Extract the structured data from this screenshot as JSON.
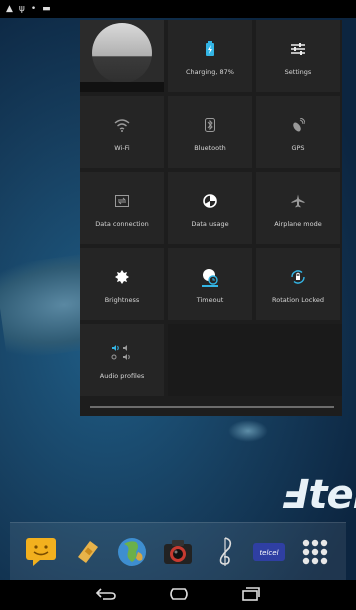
{
  "quick_settings": {
    "tiles": [
      {
        "id": "charging",
        "label": "Charging, 87%",
        "icon": "battery-charging-icon"
      },
      {
        "id": "settings",
        "label": "Settings",
        "icon": "settings-sliders-icon"
      },
      {
        "id": "wifi",
        "label": "Wi-Fi",
        "icon": "wifi-icon"
      },
      {
        "id": "bluetooth",
        "label": "Bluetooth",
        "icon": "bluetooth-icon"
      },
      {
        "id": "gps",
        "label": "GPS",
        "icon": "gps-icon"
      },
      {
        "id": "data_connection",
        "label": "Data connection",
        "icon": "data-connection-icon"
      },
      {
        "id": "data_usage",
        "label": "Data usage",
        "icon": "data-usage-icon"
      },
      {
        "id": "airplane",
        "label": "Airplane mode",
        "icon": "airplane-icon"
      },
      {
        "id": "brightness",
        "label": "Brightness",
        "icon": "brightness-icon"
      },
      {
        "id": "timeout",
        "label": "Timeout",
        "icon": "timeout-icon"
      },
      {
        "id": "rotation",
        "label": "Rotation Locked",
        "icon": "rotation-lock-icon"
      },
      {
        "id": "audio",
        "label": "Audio profiles",
        "icon": "audio-profiles-icon"
      }
    ],
    "battery_percent": 87,
    "accent_color": "#33b5e5"
  },
  "home": {
    "brand_text": "Ⅎtel",
    "dock_apps": [
      "messaging",
      "sim-toolkit",
      "browser",
      "camera",
      "music",
      "telcel-app",
      "app-drawer"
    ]
  },
  "navbar": {
    "buttons": [
      "back",
      "home",
      "recent-apps"
    ]
  }
}
